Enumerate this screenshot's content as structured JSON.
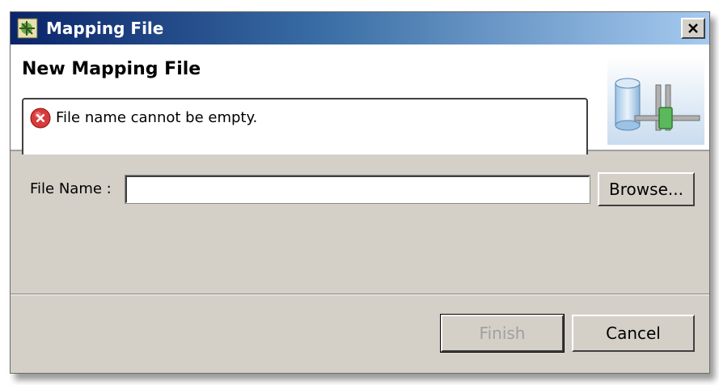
{
  "window": {
    "title": "Mapping File",
    "close_glyph": "×",
    "icon": "mapping-app-icon"
  },
  "banner": {
    "title": "New Mapping File",
    "message": "File name cannot be empty.",
    "message_icon": "error-icon",
    "image": "database-mapping-icon"
  },
  "form": {
    "file_name_label": "File Name :",
    "file_name_value": "",
    "file_name_placeholder": "",
    "browse_label": "Browse..."
  },
  "buttons": {
    "finish_label": "Finish",
    "finish_enabled": false,
    "cancel_label": "Cancel"
  },
  "colors": {
    "titlebar_start": "#0a246a",
    "titlebar_end": "#a6caf0",
    "dialog_bg": "#d4d0c8",
    "error_red": "#d93a3a"
  }
}
